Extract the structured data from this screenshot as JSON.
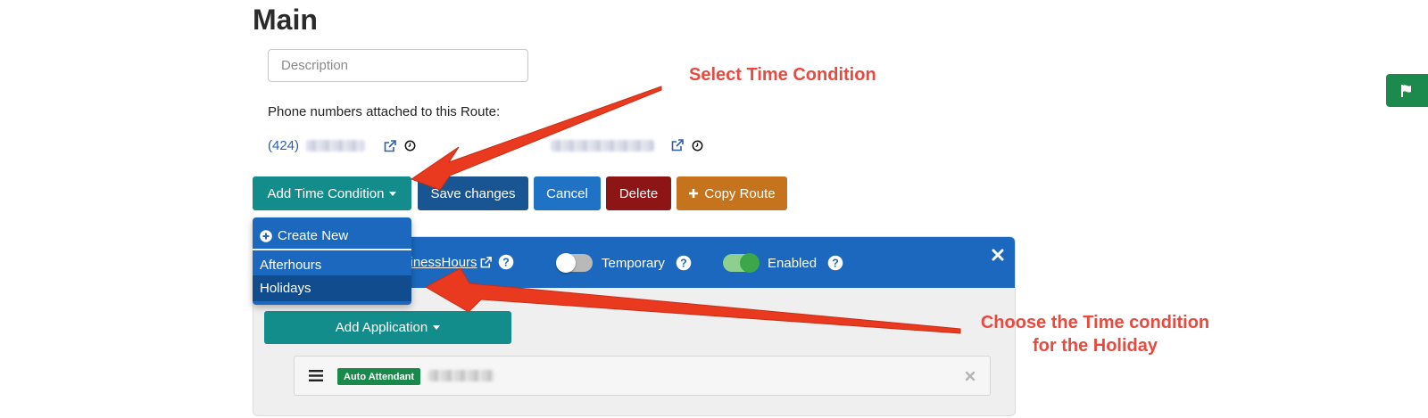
{
  "page": {
    "title": "Main",
    "description_placeholder": "Description",
    "phones_label": "Phone numbers attached to this Route:",
    "phone_area_code": "(424)"
  },
  "toolbar": {
    "add_time_condition": "Add Time Condition",
    "save_changes": "Save changes",
    "cancel": "Cancel",
    "delete": "Delete",
    "copy_route": "Copy Route"
  },
  "dropdown": {
    "create_new": "Create New",
    "items": [
      "Afterhours",
      "Holidays"
    ]
  },
  "panel": {
    "business_hours_link": "sinessHours",
    "temporary_label": "Temporary",
    "enabled_label": "Enabled",
    "add_application": "Add Application",
    "app_badge": "Auto Attendant"
  },
  "toggles": {
    "temporary": false,
    "enabled": true
  },
  "annotations": {
    "select_time_condition": "Select Time Condition",
    "choose_line1": "Choose the Time condition",
    "choose_line2": "for the Holiday"
  },
  "colors": {
    "teal": "#138d8c",
    "navy": "#185592",
    "blue": "#1f72c4",
    "red": "#8d1515",
    "orange": "#c6731d",
    "panel_header": "#1b68be",
    "annotation": "#e94a3f",
    "badge_green": "#1a8a4c"
  },
  "icons": [
    "external-link-icon",
    "clock-icon",
    "caret-down-icon",
    "plus-icon",
    "plus-circle-icon",
    "question-circle-icon",
    "close-icon",
    "hamburger-icon",
    "flag-icon"
  ]
}
